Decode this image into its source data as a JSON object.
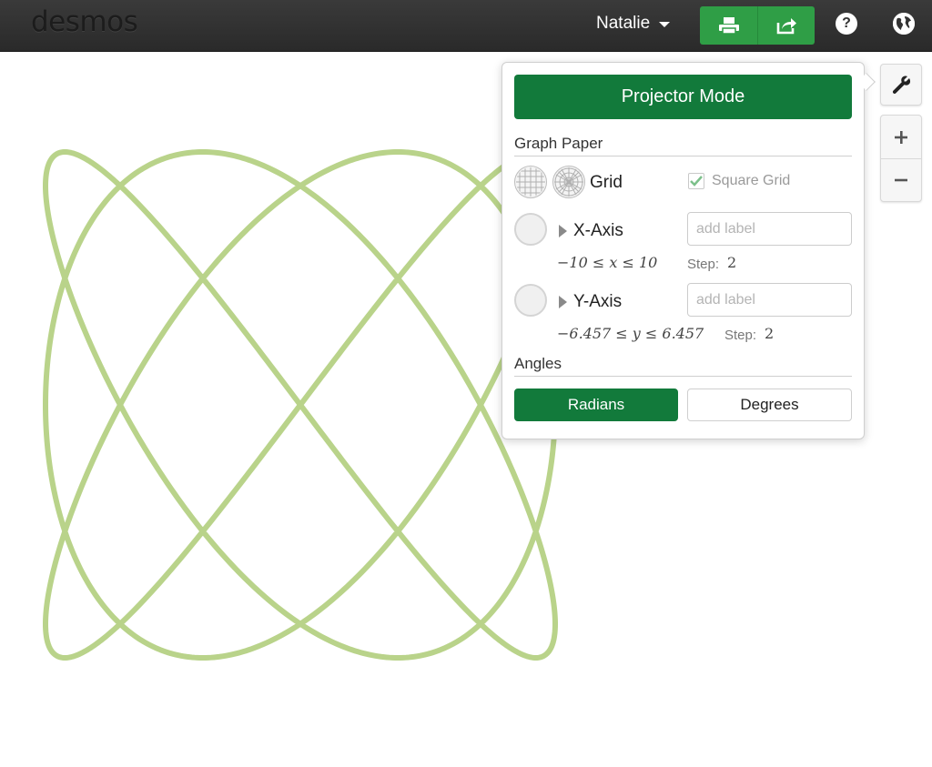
{
  "header": {
    "logo": "desmos",
    "user_name": "Natalie",
    "icons": {
      "print": "print-icon",
      "share": "share-icon",
      "help": "help-icon",
      "language": "globe-icon"
    },
    "accent_color": "#2f9e46"
  },
  "graph": {
    "curve_color": "#b9d38a",
    "curve": "lissajous"
  },
  "tools": {
    "settings_icon": "wrench-icon",
    "zoom_in_label": "+",
    "zoom_out_label": "−"
  },
  "settings_panel": {
    "projector_mode_label": "Projector Mode",
    "graph_paper_title": "Graph Paper",
    "grid_label": "Grid",
    "square_grid_label": "Square Grid",
    "square_grid_checked": true,
    "x_axis": {
      "name": "X-Axis",
      "label_placeholder": "add label",
      "bounds": "−10 ≤ x ≤ 10",
      "step_word": "Step:",
      "step_value": "2"
    },
    "y_axis": {
      "name": "Y-Axis",
      "label_placeholder": "add label",
      "bounds": "−6.457 ≤ y ≤ 6.457",
      "step_word": "Step:",
      "step_value": "2"
    },
    "angles_title": "Angles",
    "radians_label": "Radians",
    "degrees_label": "Degrees",
    "selected_angle_mode": "Radians",
    "button_color": "#127a3b"
  }
}
